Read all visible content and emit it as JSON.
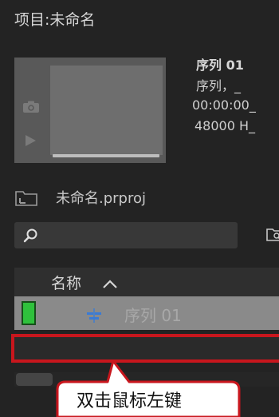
{
  "panel": {
    "title": "项目:未命名"
  },
  "sequence": {
    "name": "序列 01",
    "type": "序列，_",
    "duration": "00:00:00_",
    "audio": "48000 H_"
  },
  "project": {
    "file_name": "未命名.prproj"
  },
  "search": {
    "placeholder": ""
  },
  "list": {
    "column_name": "名称",
    "rows": [
      {
        "name": "序列 01",
        "label_color": "#2fc13c"
      }
    ]
  },
  "callout": {
    "text": "双击鼠标左键",
    "border_color": "#c8161d"
  },
  "colors": {
    "panel_bg": "#232323",
    "selected_row": "#8a8a8a",
    "highlight": "#c8161d"
  }
}
